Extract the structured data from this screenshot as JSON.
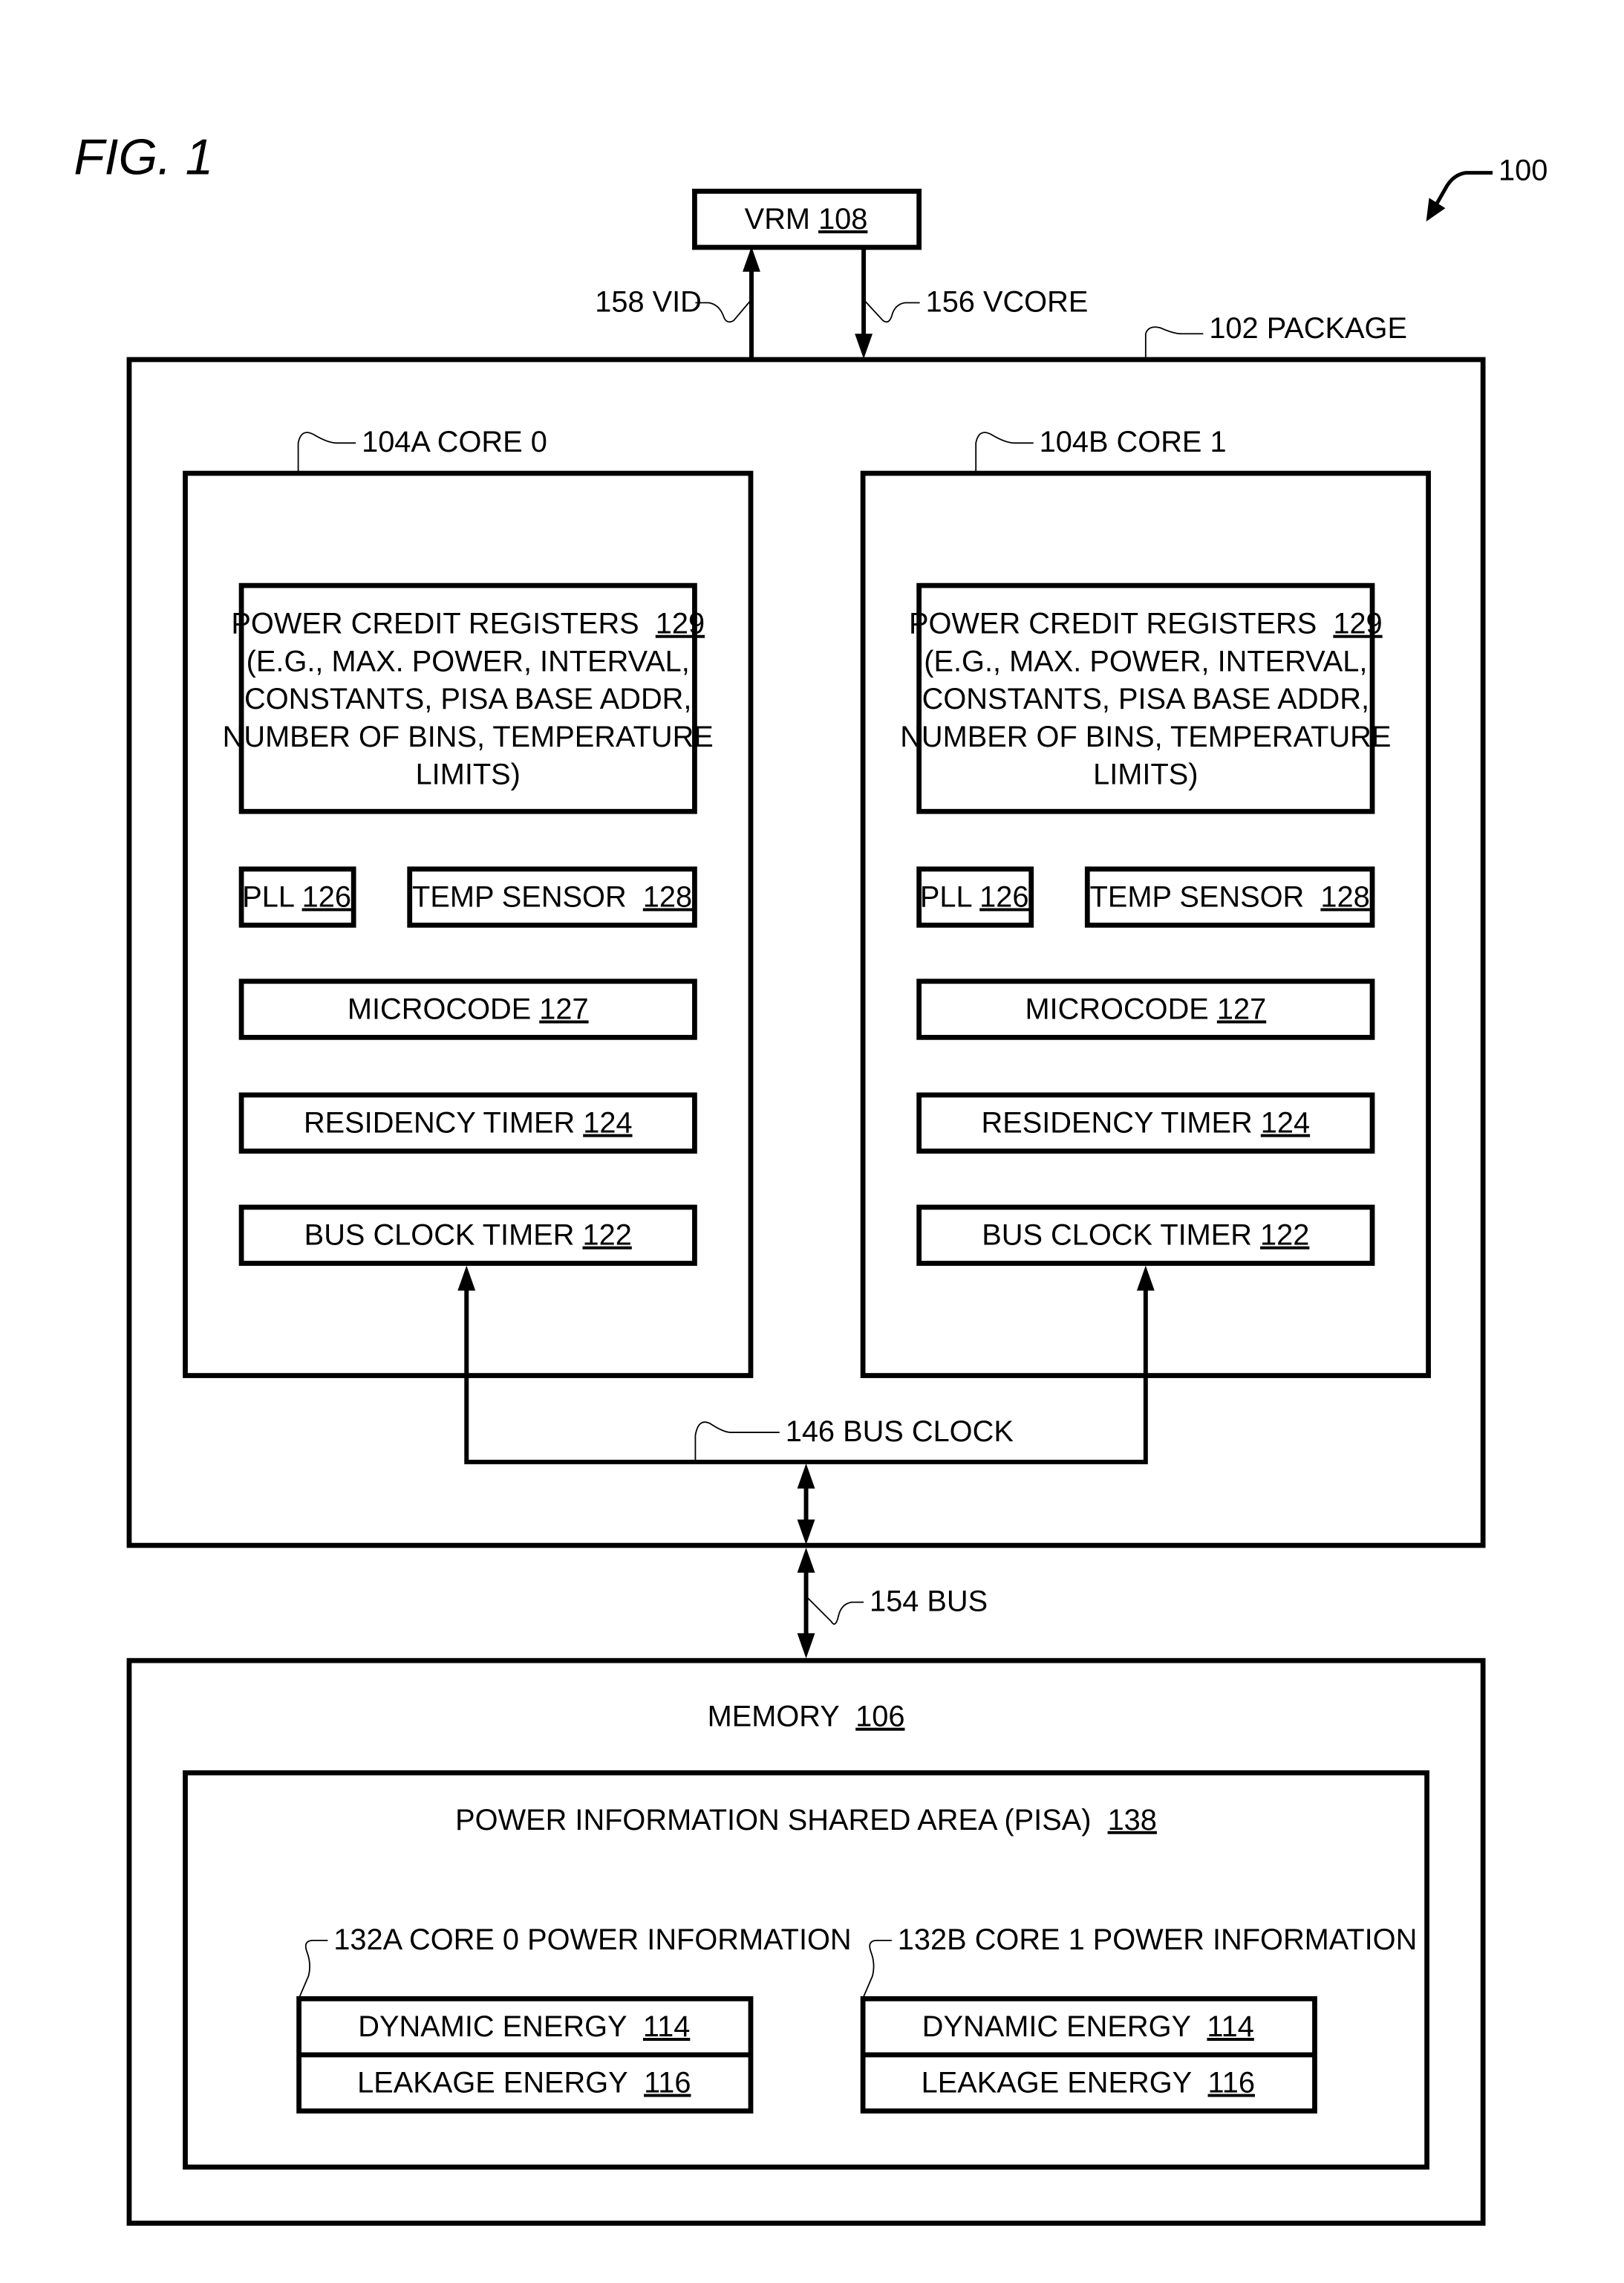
{
  "figure": {
    "title": "FIG. 1",
    "system_ref": "100"
  },
  "colors": {
    "ink": "#000000",
    "paper": "#ffffff"
  },
  "vrm": {
    "name": "VRM ",
    "ref": "108"
  },
  "signals": {
    "vid": "158 VID",
    "vcore": "156 VCORE",
    "bus_clock": "146 BUS CLOCK",
    "bus": "154 BUS"
  },
  "package": {
    "label": "102 PACKAGE"
  },
  "cores": [
    {
      "label": "104A CORE 0",
      "power_credit_registers": {
        "lines": [
          "POWER CREDIT REGISTERS  ",
          "(E.G., MAX. POWER, INTERVAL,",
          "CONSTANTS, PISA BASE ADDR,",
          "NUMBER OF BINS, TEMPERATURE",
          "LIMITS)"
        ],
        "ref": "129"
      },
      "pll": {
        "name": "PLL ",
        "ref": "126"
      },
      "temp_sensor": {
        "name": "TEMP SENSOR  ",
        "ref": "128"
      },
      "microcode": {
        "name": "MICROCODE ",
        "ref": "127"
      },
      "residency_timer": {
        "name": "RESIDENCY TIMER ",
        "ref": "124"
      },
      "bus_clock_timer": {
        "name": "BUS CLOCK TIMER ",
        "ref": "122"
      }
    },
    {
      "label": "104B CORE 1",
      "power_credit_registers": {
        "lines": [
          "POWER CREDIT REGISTERS  ",
          "(E.G., MAX. POWER, INTERVAL,",
          "CONSTANTS, PISA BASE ADDR,",
          "NUMBER OF BINS, TEMPERATURE",
          "LIMITS)"
        ],
        "ref": "129"
      },
      "pll": {
        "name": "PLL ",
        "ref": "126"
      },
      "temp_sensor": {
        "name": "TEMP SENSOR  ",
        "ref": "128"
      },
      "microcode": {
        "name": "MICROCODE ",
        "ref": "127"
      },
      "residency_timer": {
        "name": "RESIDENCY TIMER ",
        "ref": "124"
      },
      "bus_clock_timer": {
        "name": "BUS CLOCK TIMER ",
        "ref": "122"
      }
    }
  ],
  "memory": {
    "name": "MEMORY  ",
    "ref": "106",
    "pisa": {
      "name": "POWER INFORMATION SHARED AREA (PISA)  ",
      "ref": "138",
      "core_info": [
        {
          "label": "132A CORE 0 POWER INFORMATION",
          "dynamic": {
            "name": "DYNAMIC ENERGY  ",
            "ref": "114"
          },
          "leakage": {
            "name": "LEAKAGE ENERGY  ",
            "ref": "116"
          }
        },
        {
          "label": "132B CORE 1 POWER INFORMATION",
          "dynamic": {
            "name": "DYNAMIC ENERGY  ",
            "ref": "114"
          },
          "leakage": {
            "name": "LEAKAGE ENERGY  ",
            "ref": "116"
          }
        }
      ]
    }
  }
}
